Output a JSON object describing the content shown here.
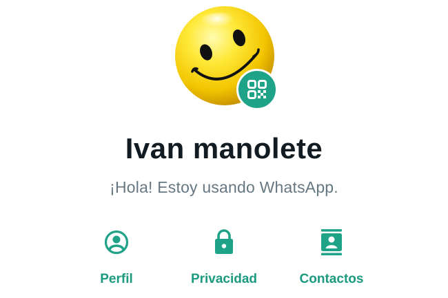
{
  "profile": {
    "name": "Ivan manolete",
    "status": "¡Hola! Estoy usando WhatsApp.",
    "avatar_icon": "smiley-face-icon",
    "qr_icon": "qr-code-icon"
  },
  "actions": [
    {
      "label": "Perfil",
      "icon": "account-circle-icon"
    },
    {
      "label": "Privacidad",
      "icon": "lock-icon"
    },
    {
      "label": "Contactos",
      "icon": "contacts-book-icon"
    }
  ],
  "colors": {
    "accent": "#1ea288",
    "label": "#1a9a7f",
    "name": "#111b21",
    "status": "#667781",
    "smiley": "#f5d400"
  }
}
